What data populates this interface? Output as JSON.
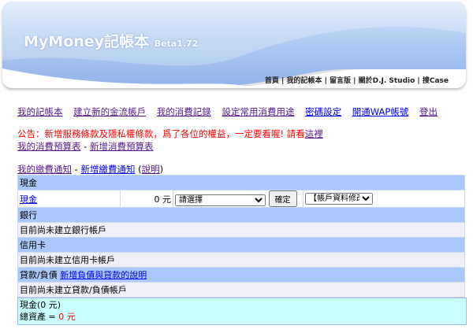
{
  "header": {
    "app_name": "MyMoney",
    "app_name_cn": "記帳本",
    "version": "Beta1.72",
    "top_links": [
      "首頁",
      "我的記帳本",
      "留言版",
      "關於D.J. Studio",
      "搜Case"
    ]
  },
  "nav": [
    "我的記帳本",
    "建立新的金流帳戶",
    "我的消費記錄",
    "設定常用消費用途",
    "密碼設定",
    "開通WAP帳號",
    "登出"
  ],
  "notice": {
    "text": "公告：新增服務條款及隱私權條款，爲了各位的權益，一定要看喔! 請看",
    "link": "這裡"
  },
  "budget": {
    "my": "我的消費預算表",
    "sep": " - ",
    "add": "新增消費預算表"
  },
  "bill": {
    "my": "我的繳費通知",
    "sep": " - ",
    "add": "新增繳費通知",
    "open": " (",
    "help": "說明",
    "close": ")"
  },
  "accounts": {
    "cash_header": "現金",
    "cash_row": {
      "name": "現金",
      "amount": "0 元",
      "select": "請選擇",
      "confirm": "確定",
      "edit_select": "【帳戶資料修改】"
    },
    "bank_header": "銀行",
    "bank_empty": "目前尚未建立銀行帳戶",
    "credit_header": "信用卡",
    "credit_empty": "目前尚未建立信用卡帳戶",
    "loan_header": "貸款/負債",
    "loan_help": "新增負債與貸款的說明",
    "loan_empty": "目前尚未建立貸款/負債帳戶"
  },
  "summary": {
    "cash": "現金(0 元)",
    "total_label": "總資產 = ",
    "total_value": "0 元"
  }
}
